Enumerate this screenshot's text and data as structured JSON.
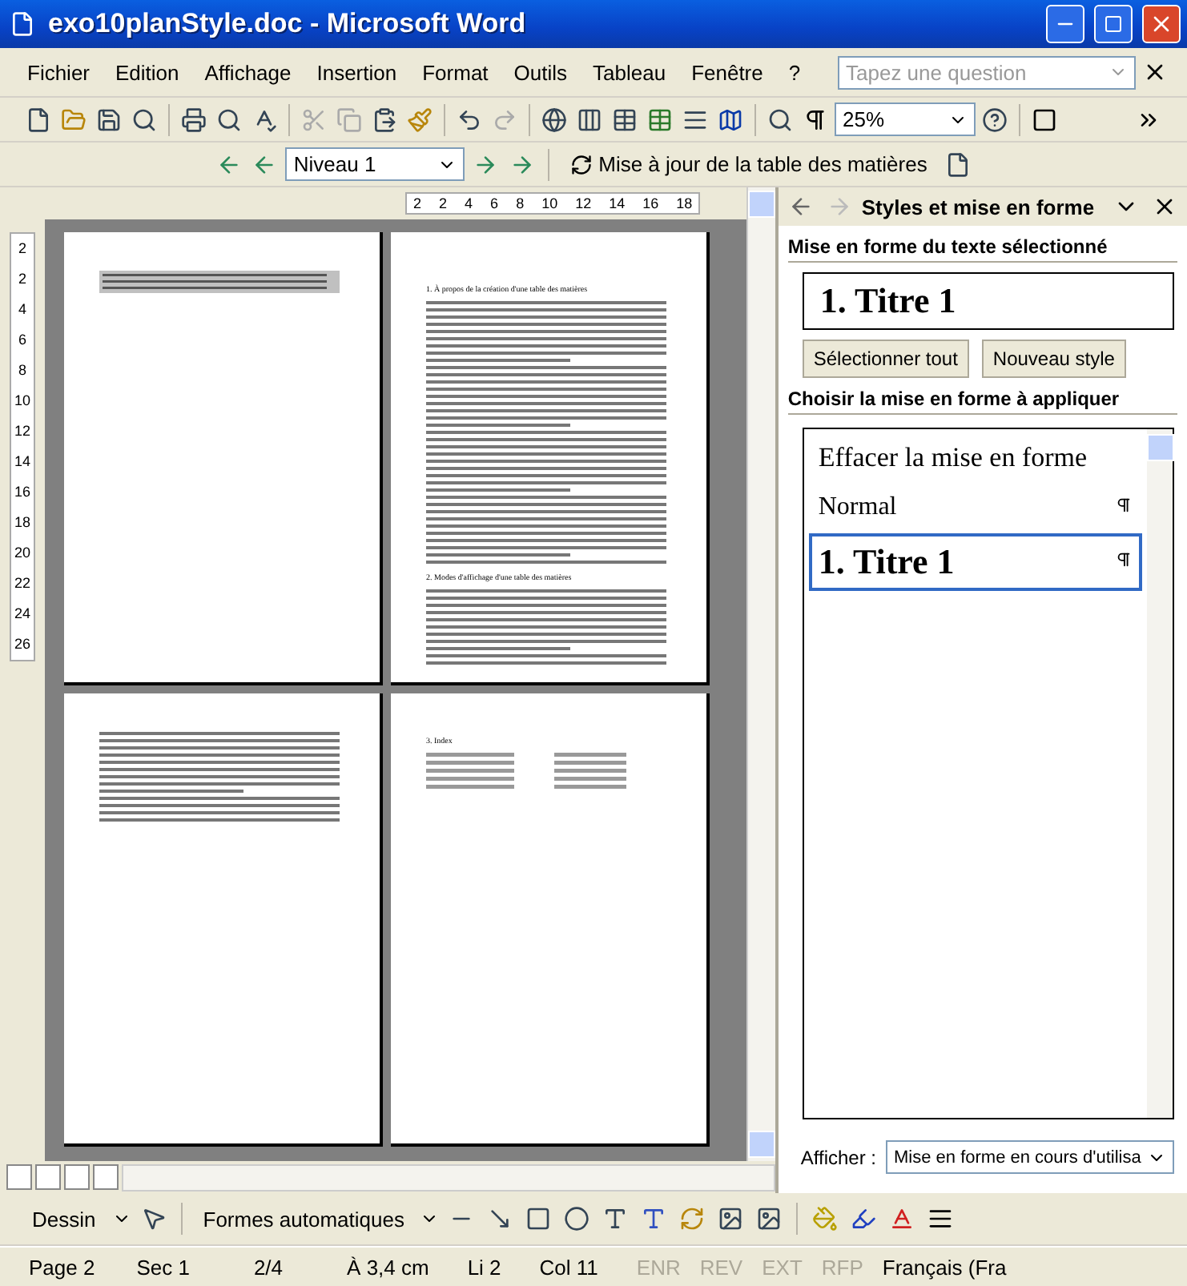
{
  "window": {
    "title": "exo10planStyle.doc - Microsoft Word"
  },
  "menu": [
    "Fichier",
    "Edition",
    "Affichage",
    "Insertion",
    "Format",
    "Outils",
    "Tableau",
    "Fenêtre",
    "?"
  ],
  "help_search": {
    "placeholder": "Tapez une question"
  },
  "zoom": {
    "value": "25%"
  },
  "outline_toolbar": {
    "level": "Niveau 1",
    "update_label": "Mise à jour de la table des matières"
  },
  "horizontal_ruler": [
    "2",
    "2",
    "4",
    "6",
    "8",
    "10",
    "12",
    "14",
    "16",
    "18"
  ],
  "vertical_ruler": [
    "2",
    "2",
    "4",
    "6",
    "8",
    "10",
    "12",
    "14",
    "16",
    "18",
    "20",
    "22",
    "24",
    "26"
  ],
  "pages": [
    {
      "kind": "toc"
    },
    {
      "kind": "text",
      "headings": [
        "1.   À propos de la création d'une table des matières",
        "2.   Modes d'affichage d'une table des matières"
      ]
    },
    {
      "kind": "text"
    },
    {
      "kind": "index",
      "headings": [
        "3.   Index"
      ]
    }
  ],
  "task_pane": {
    "title": "Styles et mise en forme",
    "selected_section": "Mise en forme du texte sélectionné",
    "current_style": "1.  Titre 1",
    "buttons": [
      "Sélectionner tout",
      "Nouveau style"
    ],
    "apply_section": "Choisir la mise en forme à appliquer",
    "styles": [
      {
        "label": "Effacer la mise en forme",
        "kind": "clear",
        "selected": false
      },
      {
        "label": "Normal",
        "kind": "paragraph",
        "selected": false
      },
      {
        "label": "1.  Titre 1",
        "kind": "heading",
        "selected": true
      }
    ],
    "show_label": "Afficher :",
    "show_value": "Mise en forme en cours d'utilisa"
  },
  "drawing_toolbar": {
    "draw": "Dessin",
    "autoshapes": "Formes automatiques"
  },
  "status_bar": [
    {
      "text": "Page 2",
      "disabled": false
    },
    {
      "text": "Sec 1",
      "disabled": false
    },
    {
      "text": "2/4",
      "disabled": false
    },
    {
      "text": "À 3,4 cm",
      "disabled": false
    },
    {
      "text": "Li 2",
      "disabled": false
    },
    {
      "text": "Col 11",
      "disabled": false
    },
    {
      "text": "ENR",
      "disabled": true
    },
    {
      "text": "REV",
      "disabled": true
    },
    {
      "text": "EXT",
      "disabled": true
    },
    {
      "text": "RFP",
      "disabled": true
    },
    {
      "text": "Français (Fra",
      "disabled": false
    }
  ]
}
